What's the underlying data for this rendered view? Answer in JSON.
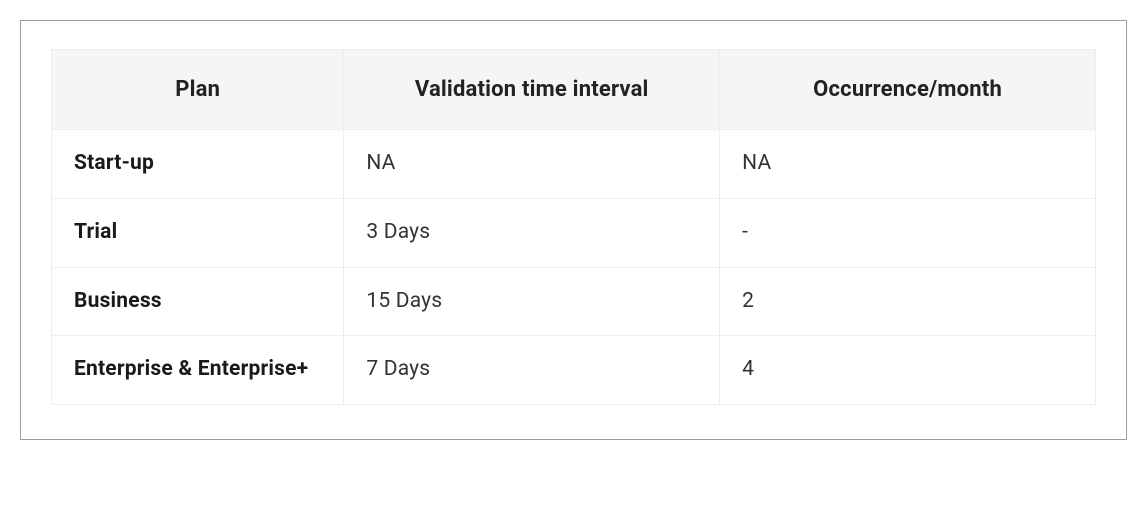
{
  "chart_data": {
    "type": "table",
    "headers": [
      "Plan",
      "Validation time interval",
      "Occurrence/month"
    ],
    "rows": [
      {
        "plan": "Start-up",
        "interval": "NA",
        "occurrence": "NA"
      },
      {
        "plan": "Trial",
        "interval": "3 Days",
        "occurrence": "-"
      },
      {
        "plan": "Business",
        "interval": "15 Days",
        "occurrence": "2"
      },
      {
        "plan": "Enterprise & Enterprise+",
        "interval": "7 Days",
        "occurrence": "4"
      }
    ]
  }
}
